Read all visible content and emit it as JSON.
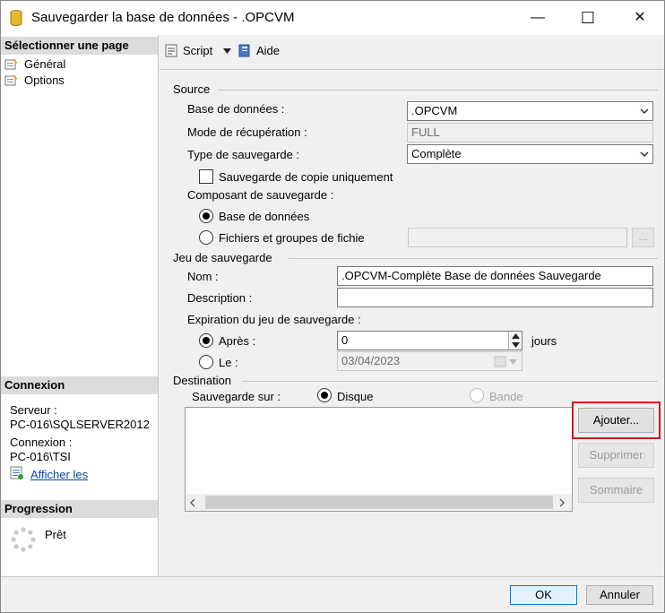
{
  "window": {
    "title": "Sauvegarder la base de données - .OPCVM",
    "minimize_glyph": "—",
    "maximize_glyph": "☐",
    "close_glyph": "✕"
  },
  "left_pane": {
    "select_page_header": "Sélectionner une page",
    "pages": [
      {
        "label": "Général"
      },
      {
        "label": "Options"
      }
    ],
    "connection_header": "Connexion",
    "server_label": "Serveur :",
    "server_value": "PC-016\\SQLSERVER2012",
    "connection_label": "Connexion :",
    "connection_value": "PC-016\\TSI",
    "view_properties_link": "Afficher les",
    "progress_header": "Progression",
    "progress_status": "Prêt"
  },
  "toolbar": {
    "script_label": "Script",
    "help_label": "Aide"
  },
  "source": {
    "group_label": "Source",
    "database_label": "Base de données :",
    "database_value": ".OPCVM",
    "recovery_label": "Mode de récupération :",
    "recovery_value": "FULL",
    "backup_type_label": "Type de sauvegarde :",
    "backup_type_value": "Complète",
    "copy_only_label": "Sauvegarde de copie uniquement",
    "component_label": "Composant de sauvegarde :",
    "component_database_label": "Base de données",
    "component_files_label": "Fichiers et groupes de fichie",
    "browse_label": "..."
  },
  "backup_set": {
    "group_label": "Jeu de sauvegarde",
    "name_label": "Nom :",
    "name_value": ".OPCVM-Complète Base de données Sauvegarde",
    "description_label": "Description :",
    "description_value": "",
    "expiration_label": "Expiration du jeu de sauvegarde :",
    "after_label": "Après :",
    "after_value": "0",
    "days_label": "jours",
    "on_label": "Le :",
    "on_value": "03/04/2023"
  },
  "destination": {
    "group_label": "Destination",
    "backup_to_label": "Sauvegarde sur :",
    "disk_label": "Disque",
    "tape_label": "Bande",
    "add_button": "Ajouter...",
    "remove_button": "Supprimer",
    "contents_button": "Sommaire"
  },
  "footer": {
    "ok_button": "OK",
    "cancel_button": "Annuler"
  },
  "colors": {
    "highlight_border": "#d9141b",
    "link": "#0645ad"
  }
}
